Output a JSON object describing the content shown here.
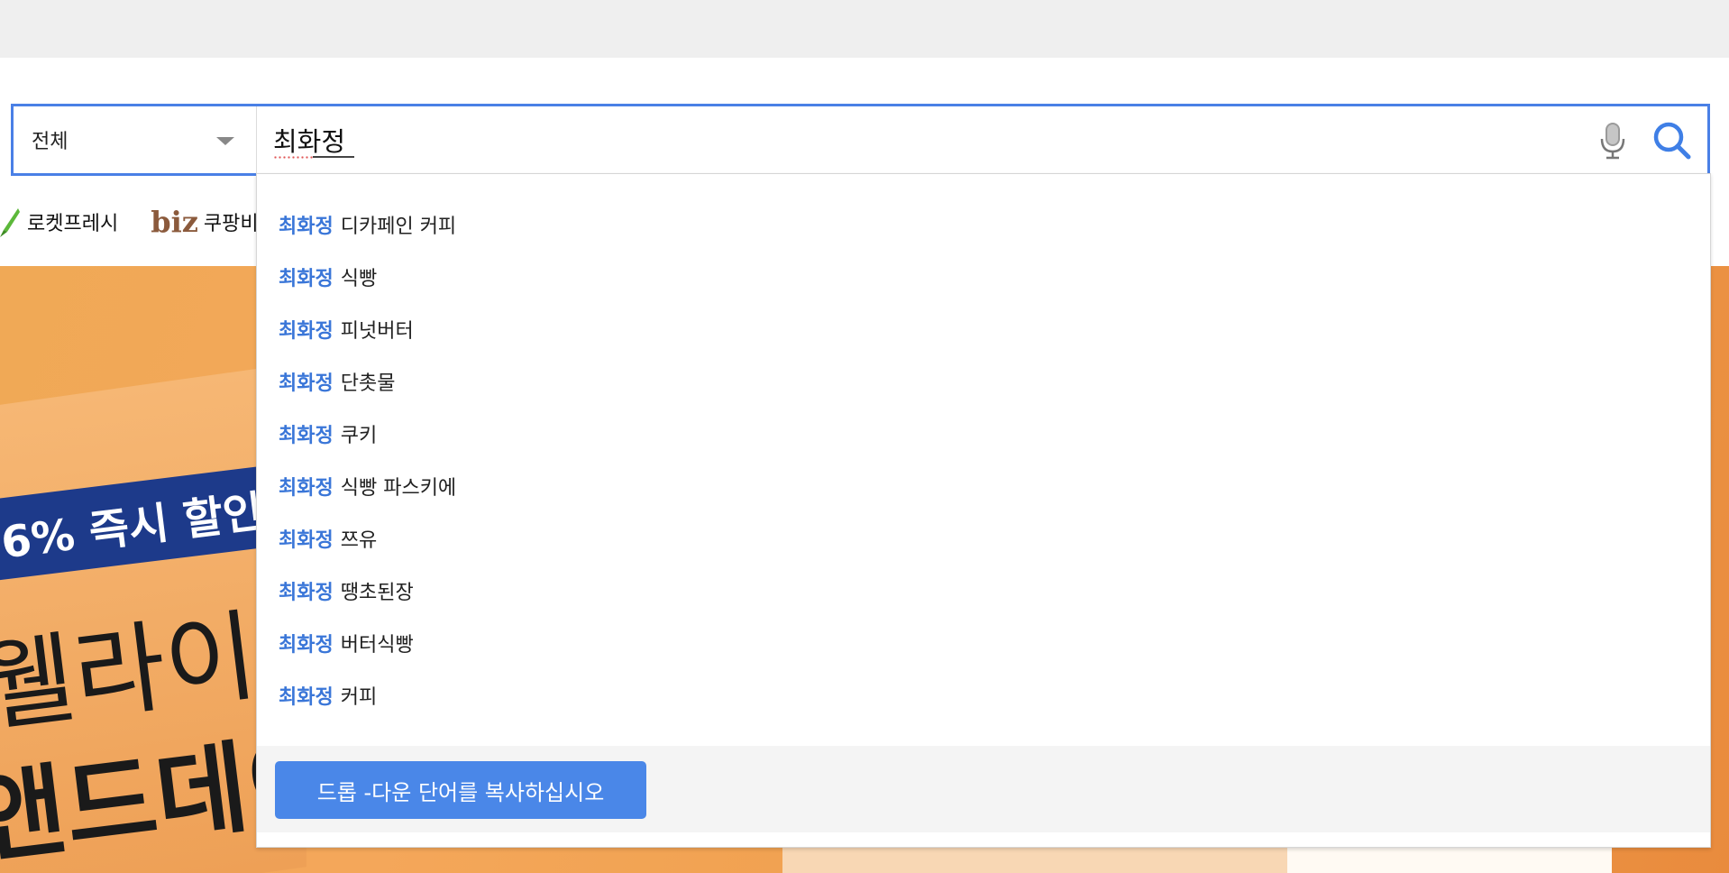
{
  "search": {
    "category": "전체",
    "query": "최화정"
  },
  "quick_links": [
    {
      "label": "로켓프레시"
    },
    {
      "logo": "biz",
      "label": "쿠팡비즈"
    }
  ],
  "banner": {
    "tag": "6% 즉시 할인",
    "line1": "웰라이",
    "line2": "앤드데이"
  },
  "suggestions": [
    {
      "prefix": "최화정",
      "rest": "디카페인 커피"
    },
    {
      "prefix": "최화정",
      "rest": "식빵"
    },
    {
      "prefix": "최화정",
      "rest": "피넛버터"
    },
    {
      "prefix": "최화정",
      "rest": "단촛물"
    },
    {
      "prefix": "최화정",
      "rest": "쿠키"
    },
    {
      "prefix": "최화정",
      "rest": "식빵 파스키에"
    },
    {
      "prefix": "최화정",
      "rest": "쯔유"
    },
    {
      "prefix": "최화정",
      "rest": "땡초된장"
    },
    {
      "prefix": "최화정",
      "rest": "버터식빵"
    },
    {
      "prefix": "최화정",
      "rest": "커피"
    }
  ],
  "dropdown_footer": {
    "copy_button": "드롭 -다운 단어를 복사하십시오"
  },
  "colors": {
    "accent": "#4a80e6",
    "highlight": "#3a76d8",
    "copy_button_bg": "#4a87e8"
  }
}
